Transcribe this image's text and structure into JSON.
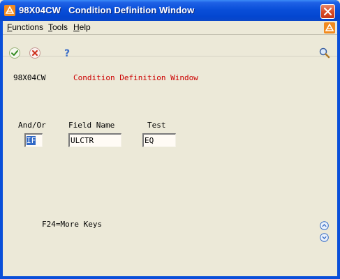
{
  "window": {
    "title": "98X04CW   Condition Definition Window"
  },
  "menu": {
    "items": [
      {
        "label": "Functions"
      },
      {
        "label": "Tools"
      },
      {
        "label": "Help"
      }
    ]
  },
  "toolbar": {
    "ok_icon": "checkmark-icon",
    "cancel_icon": "x-circle-icon",
    "help_icon": "question-mark-icon",
    "search_icon": "magnifier-icon"
  },
  "form": {
    "id": "98X04CW",
    "title": "Condition Definition Window",
    "columns": {
      "and_or": "And/Or",
      "field_name": "Field Name",
      "test": "Test"
    },
    "fields": {
      "and_or": "IF",
      "field_name": "ULCTR",
      "test": "EQ"
    },
    "function_keys": "F24=More Keys"
  },
  "colors": {
    "title_red": "#cc0000",
    "titlebar_blue": "#0a4fd9",
    "selection_blue": "#3169c6",
    "background": "#ece9d8"
  }
}
